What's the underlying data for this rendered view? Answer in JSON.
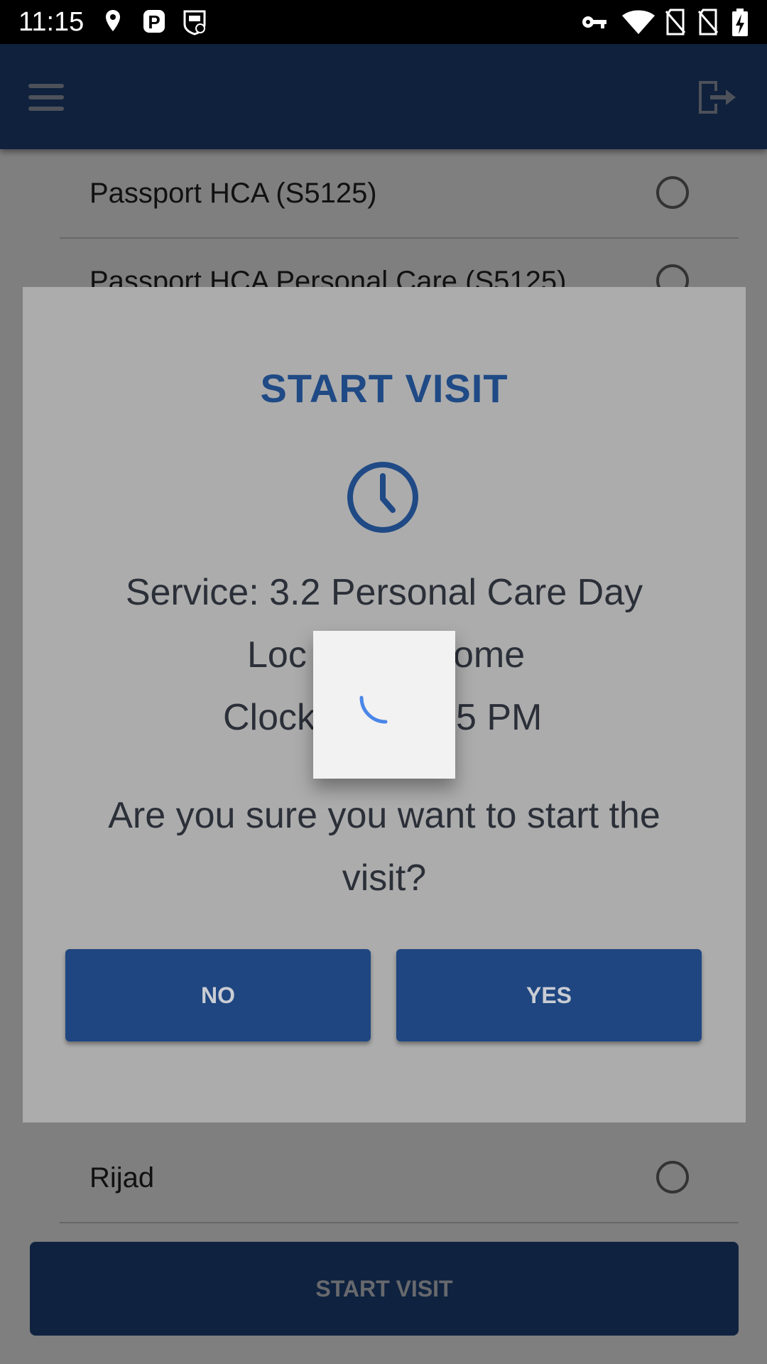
{
  "status_bar": {
    "time": "11:15",
    "left_icons": [
      "location-icon",
      "parking-icon",
      "security-shield-icon"
    ],
    "right_icons": [
      "vpn-key-icon",
      "wifi-icon",
      "no-sim-icon",
      "no-sim-icon",
      "battery-charging-icon"
    ]
  },
  "app_bar": {
    "menu_icon": "hamburger-menu-icon",
    "logout_icon": "logout-icon",
    "background": "#1e4279"
  },
  "list": {
    "items": [
      {
        "label": "Passport HCA (S5125)"
      },
      {
        "label": "Passport HCA Personal Care (S5125)"
      },
      {
        "label": "Rijad"
      }
    ]
  },
  "bottom_button": {
    "label": "START VISIT"
  },
  "dialog": {
    "title": "START VISIT",
    "icon": "clock-icon",
    "service_line": "Service: 3.2 Personal Care Day",
    "location_line": "Loc",
    "location_line_tail": "ome",
    "clock_line": "Clock",
    "clock_line_tail": "5 PM",
    "question": "Are you sure you want to start the visit?",
    "no_label": "NO",
    "yes_label": "YES"
  },
  "loader": {
    "icon": "loading-spinner-icon"
  },
  "colors": {
    "primary": "#1f4680",
    "title": "#1f4a85",
    "spinner": "#4a86e8"
  }
}
